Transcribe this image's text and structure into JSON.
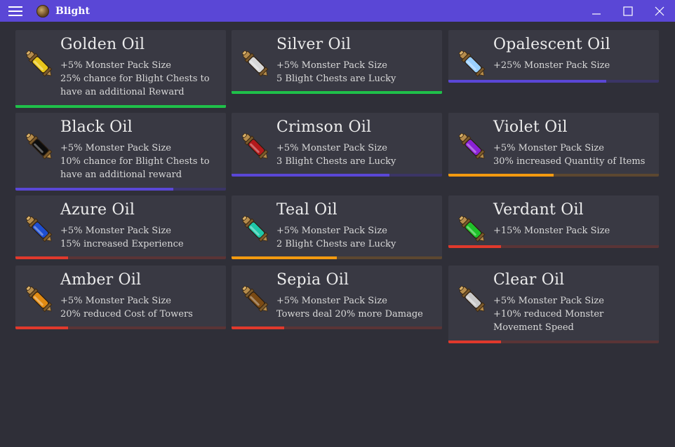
{
  "window": {
    "title": "Blight",
    "icons": {
      "menu": "hamburger-menu-icon",
      "app": "blight-app-icon",
      "minimize": "minimize-icon",
      "maximize": "maximize-icon",
      "close": "close-icon"
    }
  },
  "colors": {
    "green": "#1fc04a",
    "green_track": "#1fc04a",
    "purple": "#5a47d6",
    "purple_track": "#3b3566",
    "orange": "#f39a10",
    "orange_track": "#5c4730",
    "red": "#e0392c",
    "red_track": "#5a3436"
  },
  "oils": [
    {
      "name": "Golden Oil",
      "lines": [
        "+5% Monster Pack Size",
        "25% chance for Blight Chests to have an additional Reward"
      ],
      "rating_color": "green",
      "progress": 1.0,
      "liquid": "#e8c51a"
    },
    {
      "name": "Silver Oil",
      "lines": [
        "+5% Monster Pack Size",
        "5 Blight Chests are Lucky"
      ],
      "rating_color": "green",
      "progress": 1.0,
      "liquid": "#d8d8d8"
    },
    {
      "name": "Opalescent Oil",
      "lines": [
        "+25% Monster Pack Size"
      ],
      "rating_color": "purple",
      "progress": 0.75,
      "liquid": "#9ad0ff"
    },
    {
      "name": "Black Oil",
      "lines": [
        "+5% Monster Pack Size",
        "10% chance for Blight Chests to have an additional reward"
      ],
      "rating_color": "purple",
      "progress": 0.75,
      "liquid": "#0c0c0c"
    },
    {
      "name": "Crimson Oil",
      "lines": [
        "+5% Monster Pack Size",
        "3 Blight Chests are Lucky"
      ],
      "rating_color": "purple",
      "progress": 0.75,
      "liquid": "#b3191c"
    },
    {
      "name": "Violet Oil",
      "lines": [
        "+5% Monster Pack Size",
        "30% increased Quantity of Items"
      ],
      "rating_color": "orange",
      "progress": 0.5,
      "liquid": "#8a22d6"
    },
    {
      "name": "Azure Oil",
      "lines": [
        "+5% Monster Pack Size",
        "15% increased Experience"
      ],
      "rating_color": "red",
      "progress": 0.25,
      "liquid": "#1e4ed0"
    },
    {
      "name": "Teal Oil",
      "lines": [
        "+5% Monster Pack Size",
        "2 Blight Chests are Lucky"
      ],
      "rating_color": "orange",
      "progress": 0.5,
      "liquid": "#1fc7a8"
    },
    {
      "name": "Verdant Oil",
      "lines": [
        "+15% Monster Pack Size"
      ],
      "rating_color": "red",
      "progress": 0.25,
      "liquid": "#1fc22a"
    },
    {
      "name": "Amber Oil",
      "lines": [
        "+5% Monster Pack Size",
        "20% reduced Cost of Towers"
      ],
      "rating_color": "red",
      "progress": 0.25,
      "liquid": "#e08a12"
    },
    {
      "name": "Sepia Oil",
      "lines": [
        "+5% Monster Pack Size",
        "Towers deal 20% more Damage"
      ],
      "rating_color": "red",
      "progress": 0.25,
      "liquid": "#7a4a14"
    },
    {
      "name": "Clear Oil",
      "lines": [
        "+5% Monster Pack Size",
        "+10% reduced Monster Movement Speed"
      ],
      "rating_color": "red",
      "progress": 0.25,
      "liquid": "#c9c9c9"
    }
  ]
}
